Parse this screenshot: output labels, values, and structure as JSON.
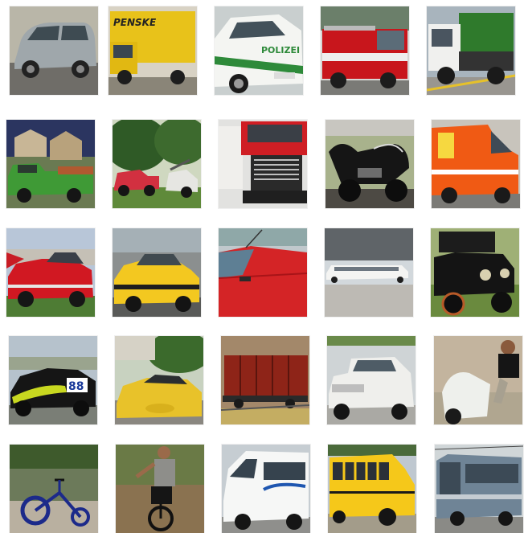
{
  "images": [
    {
      "row": 0,
      "col": 0,
      "subject": "silver minivan",
      "icon": "minivan-icon",
      "text": ""
    },
    {
      "row": 0,
      "col": 1,
      "subject": "yellow box truck",
      "icon": "box-truck-icon",
      "text": "PENSKE"
    },
    {
      "row": 0,
      "col": 2,
      "subject": "white and green police car",
      "icon": "police-car-icon",
      "text": "POLIZEI"
    },
    {
      "row": 0,
      "col": 3,
      "subject": "red and white fire truck",
      "icon": "fire-truck-icon",
      "text": ""
    },
    {
      "row": 0,
      "col": 4,
      "subject": "green garbage truck",
      "icon": "garbage-truck-icon",
      "text": ""
    },
    {
      "row": 1,
      "col": 0,
      "subject": "green pickup truck",
      "icon": "pickup-truck-icon",
      "text": ""
    },
    {
      "row": 1,
      "col": 1,
      "subject": "red tow truck",
      "icon": "tow-truck-icon",
      "text": ""
    },
    {
      "row": 1,
      "col": 2,
      "subject": "red semi truck cab",
      "icon": "semi-truck-icon",
      "text": ""
    },
    {
      "row": 1,
      "col": 3,
      "subject": "black motorcycle",
      "icon": "motorcycle-icon",
      "text": ""
    },
    {
      "row": 1,
      "col": 4,
      "subject": "orange ambulance van",
      "icon": "ambulance-icon",
      "text": ""
    },
    {
      "row": 2,
      "col": 0,
      "subject": "red classic car",
      "icon": "classic-car-icon",
      "text": ""
    },
    {
      "row": 2,
      "col": 1,
      "subject": "yellow taxi",
      "icon": "taxi-icon",
      "text": ""
    },
    {
      "row": 2,
      "col": 2,
      "subject": "red car close-up",
      "icon": "car-detail-icon",
      "text": ""
    },
    {
      "row": 2,
      "col": 3,
      "subject": "white stretch limousine",
      "icon": "limousine-icon",
      "text": ""
    },
    {
      "row": 2,
      "col": 4,
      "subject": "black vintage car",
      "icon": "vintage-car-icon",
      "text": ""
    },
    {
      "row": 3,
      "col": 0,
      "subject": "rally race car",
      "icon": "race-car-icon",
      "text": "88"
    },
    {
      "row": 3,
      "col": 1,
      "subject": "yellow sports car",
      "icon": "sports-car-icon",
      "text": ""
    },
    {
      "row": 3,
      "col": 2,
      "subject": "red freight wagon",
      "icon": "freight-wagon-icon",
      "text": ""
    },
    {
      "row": 3,
      "col": 3,
      "subject": "white vintage sedan",
      "icon": "sedan-icon",
      "text": ""
    },
    {
      "row": 3,
      "col": 4,
      "subject": "man on scooter",
      "icon": "scooter-icon",
      "text": ""
    },
    {
      "row": 4,
      "col": 0,
      "subject": "blue tricycle",
      "icon": "tricycle-icon",
      "text": ""
    },
    {
      "row": 4,
      "col": 1,
      "subject": "man on unicycle",
      "icon": "unicycle-icon",
      "text": ""
    },
    {
      "row": 4,
      "col": 2,
      "subject": "white minibus van",
      "icon": "minibus-icon",
      "text": ""
    },
    {
      "row": 4,
      "col": 3,
      "subject": "yellow school bus",
      "icon": "school-bus-icon",
      "text": ""
    },
    {
      "row": 4,
      "col": 4,
      "subject": "grey trolleybus",
      "icon": "trolleybus-icon",
      "text": ""
    }
  ]
}
